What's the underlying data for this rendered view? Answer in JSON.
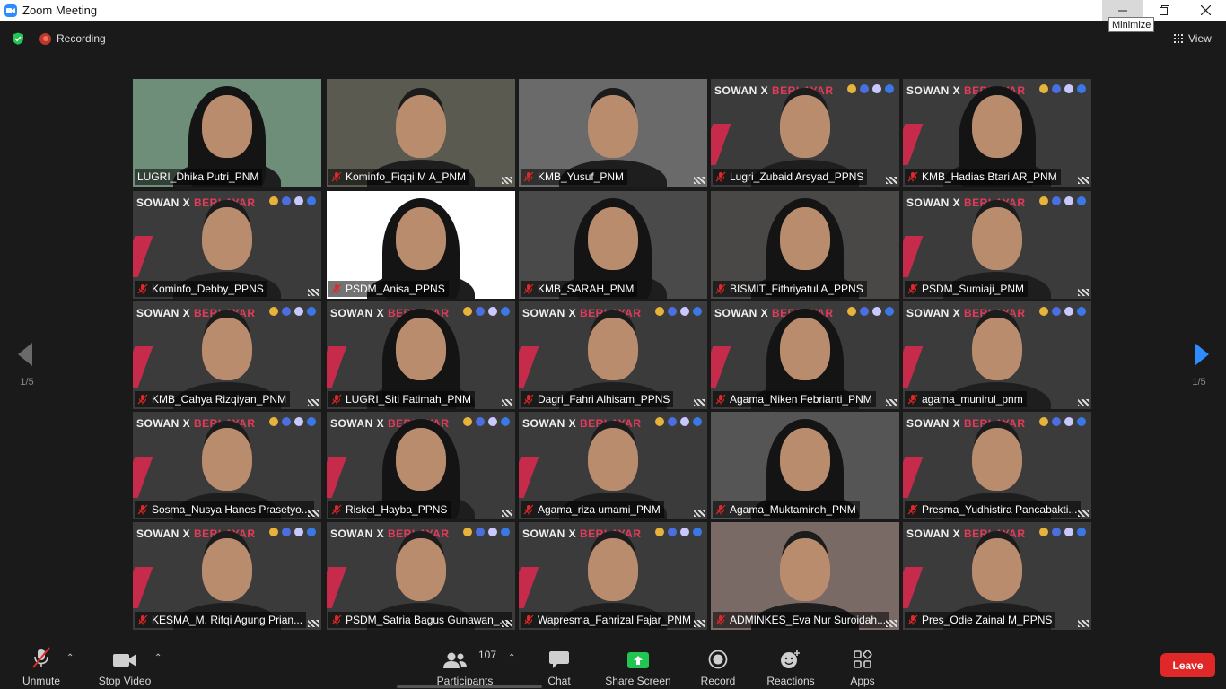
{
  "window": {
    "title": "Zoom Meeting",
    "tooltip": "Minimize"
  },
  "topbar": {
    "recording_label": "Recording",
    "view_label": "View"
  },
  "banner": {
    "word1": "SOWAN X ",
    "word2": "BERLAYAR"
  },
  "pagination": {
    "left": "1/5",
    "right": "1/5"
  },
  "participants": [
    {
      "name": "LUGRI_Dhika Putri_PNM",
      "muted": false,
      "active": true,
      "bg": "#6f8e7a",
      "style": "hijab",
      "banner": false
    },
    {
      "name": "Kominfo_Fiqqi M A_PNM",
      "muted": true,
      "bg": "#5a5a50",
      "style": "face",
      "banner": false
    },
    {
      "name": "KMB_Yusuf_PNM",
      "muted": true,
      "bg": "#6a6a6a",
      "style": "face",
      "banner": false
    },
    {
      "name": "Lugri_Zubaid Arsyad_PPNS",
      "muted": true,
      "bg": "#3b3b3b",
      "style": "face",
      "banner": true
    },
    {
      "name": "KMB_Hadias Btari AR_PNM",
      "muted": true,
      "bg": "#3b3b3b",
      "style": "hijab",
      "banner": true
    },
    {
      "name": "Kominfo_Debby_PPNS",
      "muted": true,
      "bg": "#3b3b3b",
      "style": "face",
      "banner": true
    },
    {
      "name": "PSDM_Anisa_PPNS",
      "muted": true,
      "bg": "#ffffff",
      "style": "hijab",
      "banner": false
    },
    {
      "name": "KMB_SARAH_PNM",
      "muted": true,
      "bg": "#4a4a4a",
      "style": "hijab",
      "banner": false
    },
    {
      "name": "BISMIT_Fithriyatul A_PPNS",
      "muted": true,
      "bg": "#4a4747",
      "style": "hijab",
      "banner": false
    },
    {
      "name": "PSDM_Sumiaji_PNM",
      "muted": true,
      "bg": "#3b3b3b",
      "style": "face",
      "banner": true
    },
    {
      "name": "KMB_Cahya Rizqiyan_PNM",
      "muted": true,
      "bg": "#3b3b3b",
      "style": "face",
      "banner": true
    },
    {
      "name": "LUGRI_Siti Fatimah_PNM",
      "muted": true,
      "bg": "#3b3b3b",
      "style": "hijab",
      "banner": true
    },
    {
      "name": "Dagri_Fahri Alhisam_PPNS",
      "muted": true,
      "bg": "#3b3b3b",
      "style": "face",
      "banner": true
    },
    {
      "name": "Agama_Niken Febrianti_PNM",
      "muted": true,
      "bg": "#3b3b3b",
      "style": "hijab",
      "banner": true
    },
    {
      "name": "agama_munirul_pnm",
      "muted": true,
      "bg": "#3b3b3b",
      "style": "face",
      "banner": true
    },
    {
      "name": "Sosma_Nusya Hanes Prasetyo...",
      "muted": true,
      "bg": "#3b3b3b",
      "style": "face",
      "banner": true
    },
    {
      "name": "Riskel_Hayba_PPNS",
      "muted": true,
      "bg": "#3b3b3b",
      "style": "hijab",
      "banner": true
    },
    {
      "name": "Agama_riza umami_PNM",
      "muted": true,
      "bg": "#3b3b3b",
      "style": "face",
      "banner": true
    },
    {
      "name": "Agama_Muktamiroh_PNM",
      "muted": true,
      "bg": "#555",
      "style": "hijab",
      "banner": false
    },
    {
      "name": "Presma_Yudhistira Pancabakti...",
      "muted": true,
      "bg": "#3b3b3b",
      "style": "face",
      "banner": true
    },
    {
      "name": "KESMA_M. Rifqi Agung Prian...",
      "muted": true,
      "bg": "#3b3b3b",
      "style": "face",
      "banner": true
    },
    {
      "name": "PSDM_Satria Bagus Gunawan_...",
      "muted": true,
      "bg": "#3b3b3b",
      "style": "face",
      "banner": true
    },
    {
      "name": "Wapresma_Fahrizal Fajar_PNM",
      "muted": true,
      "bg": "#3b3b3b",
      "style": "face",
      "banner": true
    },
    {
      "name": "ADMINKES_Eva Nur Suroidah...",
      "muted": true,
      "bg": "#7a6a66",
      "style": "face",
      "banner": false
    },
    {
      "name": "Pres_Odie Zainal M_PPNS",
      "muted": true,
      "bg": "#3b3b3b",
      "style": "face",
      "banner": true
    }
  ],
  "toolbar": {
    "unmute": "Unmute",
    "stop_video": "Stop Video",
    "participants": "Participants",
    "participant_count": "107",
    "chat": "Chat",
    "share_screen": "Share Screen",
    "record": "Record",
    "reactions": "Reactions",
    "apps": "Apps",
    "leave": "Leave"
  },
  "colors": {
    "active_speaker": "#d6e858",
    "share_green": "#2bd46a",
    "leave_red": "#e02828",
    "zoom_blue": "#2d8cff"
  }
}
